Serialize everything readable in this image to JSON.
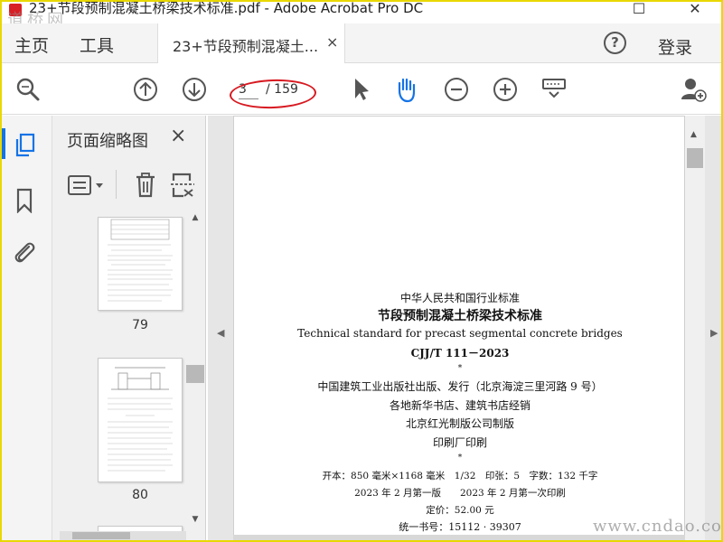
{
  "window": {
    "title": "23+节段预制混凝土桥梁技术标准.pdf - Adobe Acrobat Pro DC",
    "watermark_top_left": "道桥网"
  },
  "menubar": {
    "home": "主页",
    "tools": "工具",
    "tab_label": "23+节段预制混凝土...",
    "tab_close": "×",
    "help": "?",
    "login": "登录"
  },
  "toolbar": {
    "current_page": "3",
    "total_pages": "/ 159"
  },
  "thumbnail_panel": {
    "title": "页面缩略图",
    "close": "×",
    "pages": [
      "79",
      "80"
    ]
  },
  "document_page": {
    "lines": [
      "中华人民共和国行业标准",
      "节段预制混凝土桥梁技术标准",
      "Technical standard for precast segmental concrete bridges",
      "CJJ/T 111－2023",
      "*",
      "中国建筑工业出版社出版、发行（北京海淀三里河路 9 号）",
      "各地新华书店、建筑书店经销",
      "北京红光制版公司制版",
      "印刷厂印刷",
      "*",
      "开本：850 毫米×1168 毫米　1/32　印张：5　字数：132 千字",
      "2023 年 2 月第一版　　2023 年 2 月第一次印刷",
      "定价：52.00 元",
      "统一书号：15112 · 39307"
    ]
  },
  "watermark_bottom_right": "www.cndao.com",
  "colors": {
    "accent_blue": "#1473e6",
    "annotation_red": "#d71920",
    "border_yellow": "#e8d800"
  }
}
